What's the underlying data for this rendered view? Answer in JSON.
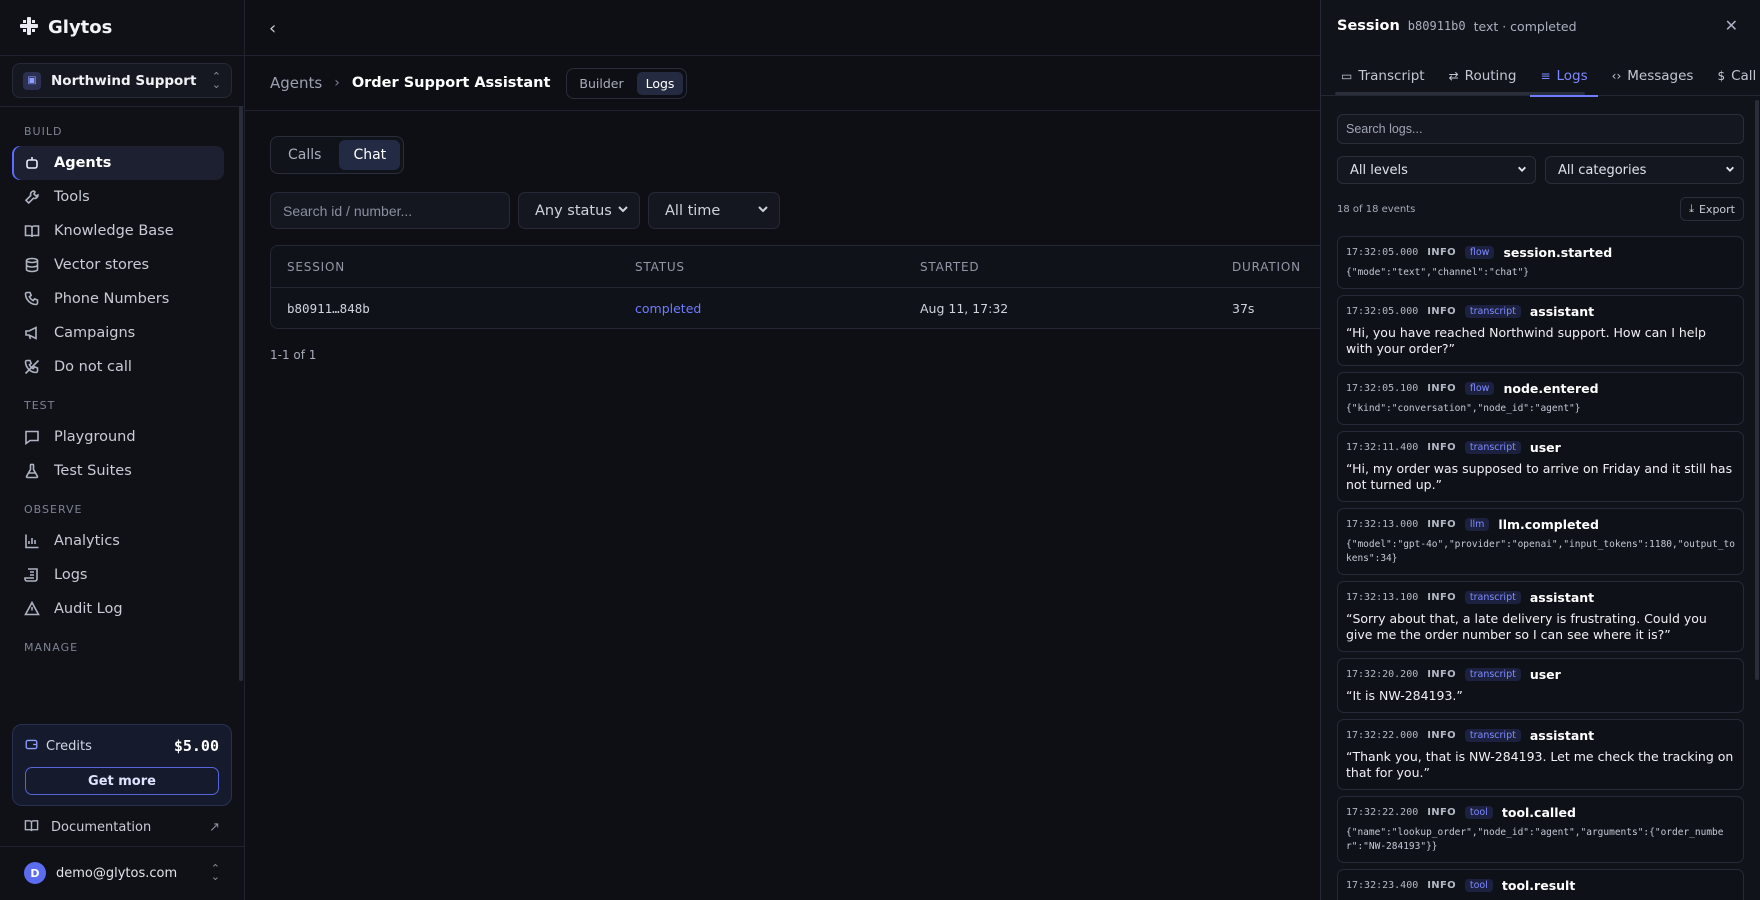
{
  "brand": {
    "name": "Glytos"
  },
  "workspace": {
    "name": "Northwind Support"
  },
  "sidebar": {
    "sections": [
      {
        "label": "BUILD",
        "items": [
          {
            "label": "Agents",
            "icon": "bot-icon",
            "active": true
          },
          {
            "label": "Tools",
            "icon": "wrench-icon"
          },
          {
            "label": "Knowledge Base",
            "icon": "book-icon"
          },
          {
            "label": "Vector stores",
            "icon": "database-icon"
          },
          {
            "label": "Phone Numbers",
            "icon": "phone-icon"
          },
          {
            "label": "Campaigns",
            "icon": "megaphone-icon"
          },
          {
            "label": "Do not call",
            "icon": "phone-off-icon"
          }
        ]
      },
      {
        "label": "TEST",
        "items": [
          {
            "label": "Playground",
            "icon": "chat-icon"
          },
          {
            "label": "Test Suites",
            "icon": "flask-icon"
          }
        ]
      },
      {
        "label": "OBSERVE",
        "items": [
          {
            "label": "Analytics",
            "icon": "chart-icon"
          },
          {
            "label": "Logs",
            "icon": "scroll-icon"
          },
          {
            "label": "Audit Log",
            "icon": "alert-icon"
          }
        ]
      },
      {
        "label": "MANAGE",
        "items": []
      }
    ],
    "credits": {
      "label": "Credits",
      "value": "$5.00",
      "button": "Get more"
    },
    "documentation": "Documentation",
    "user": {
      "initial": "D",
      "email": "demo@glytos.com"
    }
  },
  "breadcrumb": {
    "root": "Agents",
    "current": "Order Support Assistant"
  },
  "view_toggle": {
    "builder": "Builder",
    "logs": "Logs"
  },
  "mode_toggle": {
    "calls": "Calls",
    "chat": "Chat"
  },
  "filters": {
    "search_placeholder": "Search id / number...",
    "status": "Any status",
    "time": "All time"
  },
  "table": {
    "headers": {
      "session": "SESSION",
      "status": "STATUS",
      "started": "STARTED",
      "duration": "DURATION"
    },
    "rows": [
      {
        "session": "b80911…848b",
        "status": "completed",
        "started": "Aug 11, 17:32",
        "duration": "37s"
      }
    ],
    "pager": "1-1 of 1"
  },
  "panel": {
    "title": "Session",
    "session_id": "b80911b0",
    "meta": "text · completed",
    "tabs": [
      "Transcript",
      "Routing",
      "Logs",
      "Messages",
      "Call Cost"
    ],
    "active_tab": "Logs",
    "search_placeholder": "Search logs...",
    "level_filter": "All levels",
    "category_filter": "All categories",
    "count": "18 of 18 events",
    "export": "Export",
    "events": [
      {
        "time": "17:32:05.000",
        "level": "INFO",
        "category": "flow",
        "name": "session.started",
        "json": "{\"mode\":\"text\",\"channel\":\"chat\"}"
      },
      {
        "time": "17:32:05.000",
        "level": "INFO",
        "category": "transcript",
        "name": "assistant",
        "text": "“Hi, you have reached Northwind support. How can I help with your order?”"
      },
      {
        "time": "17:32:05.100",
        "level": "INFO",
        "category": "flow",
        "name": "node.entered",
        "json": "{\"kind\":\"conversation\",\"node_id\":\"agent\"}"
      },
      {
        "time": "17:32:11.400",
        "level": "INFO",
        "category": "transcript",
        "name": "user",
        "text": "“Hi, my order was supposed to arrive on Friday and it still has not turned up.”"
      },
      {
        "time": "17:32:13.000",
        "level": "INFO",
        "category": "llm",
        "name": "llm.completed",
        "json": "{\"model\":\"gpt-4o\",\"provider\":\"openai\",\"input_tokens\":1180,\"output_tokens\":34}"
      },
      {
        "time": "17:32:13.100",
        "level": "INFO",
        "category": "transcript",
        "name": "assistant",
        "text": "“Sorry about that, a late delivery is frustrating. Could you give me the order number so I can see where it is?”"
      },
      {
        "time": "17:32:20.200",
        "level": "INFO",
        "category": "transcript",
        "name": "user",
        "text": "“It is NW-284193.”"
      },
      {
        "time": "17:32:22.000",
        "level": "INFO",
        "category": "transcript",
        "name": "assistant",
        "text": "“Thank you, that is NW-284193. Let me check the tracking on that for you.”"
      },
      {
        "time": "17:32:22.200",
        "level": "INFO",
        "category": "tool",
        "name": "tool.called",
        "json": "{\"name\":\"lookup_order\",\"node_id\":\"agent\",\"arguments\":{\"order_number\":\"NW-284193\"}}"
      },
      {
        "time": "17:32:23.400",
        "level": "INFO",
        "category": "tool",
        "name": "tool.result",
        "json": ""
      }
    ]
  }
}
